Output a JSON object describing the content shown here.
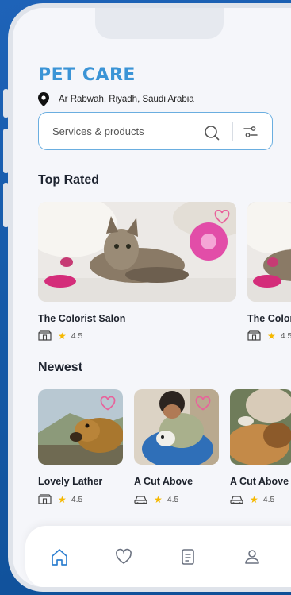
{
  "app": {
    "brand": "PET CARE",
    "location": "Ar Rabwah, Riyadh, Saudi Arabia",
    "accent": "#3b94d6",
    "heart_color": "#e8639b"
  },
  "search": {
    "placeholder": "Services & products",
    "icon": "search-icon",
    "filter_icon": "filter-icon"
  },
  "top_rated": {
    "title": "Top Rated",
    "items": [
      {
        "name": "The Colorist Salon",
        "rating": "4.5",
        "icon": "store-icon"
      },
      {
        "name": "The Colorist Salon",
        "rating": "4.5",
        "icon": "store-icon"
      }
    ]
  },
  "newest": {
    "title": "Newest",
    "items": [
      {
        "name": "Lovely Lather",
        "rating": "4.5",
        "icon": "store-icon"
      },
      {
        "name": "A Cut Above",
        "rating": "4.5",
        "icon": "car-icon"
      },
      {
        "name": "A Cut Above",
        "rating": "4.5",
        "icon": "car-icon"
      }
    ]
  },
  "tabbar": {
    "items": [
      "home-icon",
      "heart-icon",
      "orders-icon",
      "profile-icon"
    ],
    "active_color": "#2f80d0",
    "inactive_color": "#6b7280"
  }
}
